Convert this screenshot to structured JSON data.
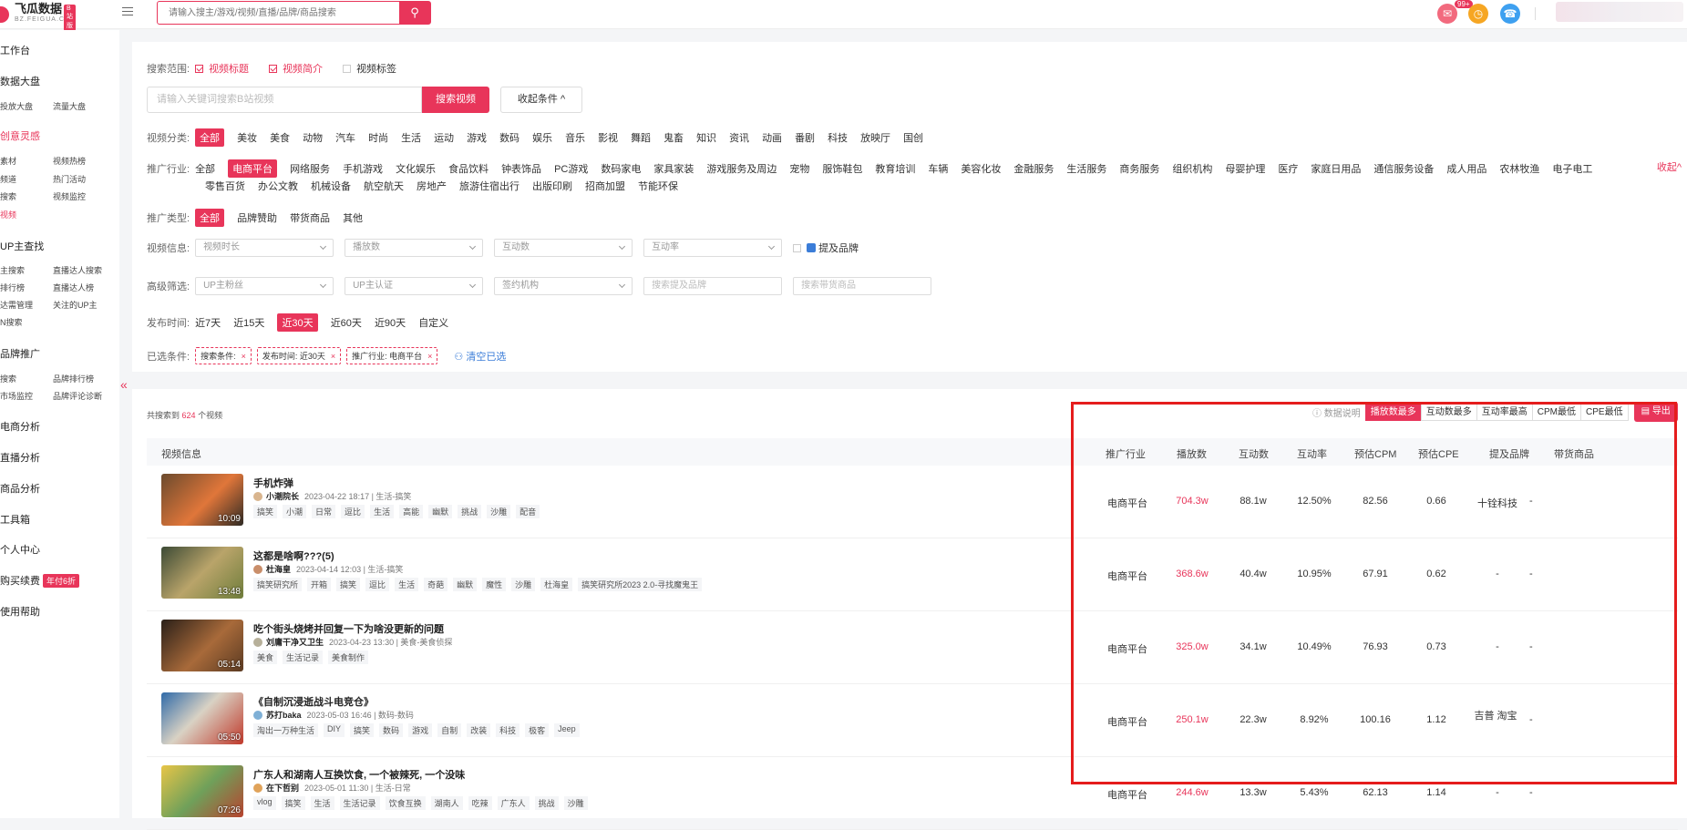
{
  "brand": {
    "name": "飞瓜数据",
    "sub": "BZ.FEIGUA.CN",
    "badge": "B站版"
  },
  "top_search": {
    "placeholder": "请输入搜主/游戏/视频/直播/品牌/商品搜索"
  },
  "notify_badge": "99+",
  "sidebar": {
    "sections": [
      {
        "label": "工作台",
        "active": false
      },
      {
        "label": "数据大盘",
        "active": false,
        "items": [
          "投放大盘",
          "流量大盘"
        ]
      },
      {
        "label": "创意灵感",
        "active": true,
        "items": [
          "素材",
          "视频热榜",
          "频道",
          "热门活动",
          "搜索",
          "视频监控",
          "视频"
        ]
      },
      {
        "label": "UP主查找",
        "active": false,
        "items": [
          "主搜索",
          "直播达人搜索",
          "排行榜",
          "直播达人榜",
          "达需管理",
          "关注的UP主",
          "N搜索"
        ]
      },
      {
        "label": "品牌推广",
        "active": false,
        "items": [
          "搜索",
          "品牌排行榜",
          "市场监控",
          "品牌评论诊断"
        ]
      },
      {
        "label": "电商分析",
        "active": false
      },
      {
        "label": "直播分析",
        "active": false
      },
      {
        "label": "商品分析",
        "active": false
      },
      {
        "label": "工具箱",
        "active": false
      },
      {
        "label": "个人中心",
        "active": false
      },
      {
        "label": "购买续费",
        "active": false,
        "tag": "年付6折"
      },
      {
        "label": "使用帮助",
        "active": false
      }
    ]
  },
  "filters": {
    "scope_label": "搜索范围:",
    "scope": [
      {
        "label": "视频标题",
        "on": true
      },
      {
        "label": "视频简介",
        "on": true
      },
      {
        "label": "视频标签",
        "on": false
      }
    ],
    "keyword_placeholder": "请输入关键词搜索B站视频",
    "search_btn": "搜索视频",
    "collapse_btn": "收起条件 ^",
    "category_label": "视频分类:",
    "categories": [
      "全部",
      "美妆",
      "美食",
      "动物",
      "汽车",
      "时尚",
      "生活",
      "运动",
      "游戏",
      "数码",
      "娱乐",
      "音乐",
      "影视",
      "舞蹈",
      "鬼畜",
      "知识",
      "资讯",
      "动画",
      "番剧",
      "科技",
      "放映厅",
      "国创"
    ],
    "industry_label": "推广行业:",
    "industries_row1": [
      "全部",
      "电商平台",
      "网络服务",
      "手机游戏",
      "文化娱乐",
      "食品饮料",
      "钟表饰品",
      "PC游戏",
      "数码家电",
      "家具家装",
      "游戏服务及周边",
      "宠物",
      "服饰鞋包",
      "教育培训",
      "车辆",
      "美容化妆",
      "金融服务",
      "生活服务",
      "商务服务",
      "组织机构",
      "母婴护理",
      "医疗",
      "家庭日用品",
      "通信服务设备",
      "成人用品",
      "农林牧渔",
      "电子电工"
    ],
    "industries_row2": [
      "零售百货",
      "办公文教",
      "机械设备",
      "航空航天",
      "房地产",
      "旅游住宿出行",
      "出版印刷",
      "招商加盟",
      "节能环保"
    ],
    "fold_right": "收起^",
    "promo_label": "推广类型:",
    "promo_types": [
      "全部",
      "品牌赞助",
      "带货商品",
      "其他"
    ],
    "info_label": "视频信息:",
    "info_selects": [
      "视频时长",
      "播放数",
      "互动数",
      "互动率"
    ],
    "info_checkbox": "提及品牌",
    "adv_label": "高级筛选:",
    "adv_selects": [
      "UP主粉丝",
      "UP主认证",
      "签约机构"
    ],
    "adv_search": [
      "搜索提及品牌",
      "搜索带货商品"
    ],
    "time_label": "发布时间:",
    "times": [
      "近7天",
      "近15天",
      "近30天",
      "近60天",
      "近90天",
      "自定义"
    ],
    "chosen_label": "已选条件:",
    "chips": [
      "搜索条件:",
      "发布时间: 近30天",
      "推广行业: 电商平台"
    ],
    "clear": "清空已选"
  },
  "results": {
    "count_prefix": "共搜索到",
    "count": "624",
    "count_suffix": "个视频",
    "help": "数据说明",
    "sorts": [
      "播放数最多",
      "互动数最多",
      "互动率最高",
      "CPM最低",
      "CPE最低"
    ],
    "export": "导出",
    "headers": [
      "视频信息",
      "推广行业",
      "播放数",
      "互动数",
      "互动率",
      "预估CPM",
      "预估CPE",
      "提及品牌",
      "带货商品"
    ],
    "rows": [
      {
        "title": "手机炸弹",
        "author": "小潮院长",
        "date": "2023-04-22 18:17",
        "cat": "生活-搞笑",
        "duration": "10:09",
        "tags": [
          "搞笑",
          "小潮",
          "日常",
          "逗比",
          "生活",
          "高能",
          "幽默",
          "挑战",
          "沙雕",
          "配音"
        ],
        "industry": "电商平台",
        "plays": "704.3w",
        "interact": "88.1w",
        "rate": "12.50%",
        "cpm": "82.56",
        "cpe": "0.66",
        "brand": "十铨科技",
        "goods": "-"
      },
      {
        "title": "这都是啥啊???(5)",
        "author": "杜海皇",
        "date": "2023-04-14 12:03",
        "cat": "生活-搞笑",
        "duration": "13:48",
        "tags": [
          "搞笑研究所",
          "开箱",
          "搞笑",
          "逗比",
          "生活",
          "奇葩",
          "幽默",
          "魔性",
          "沙雕",
          "杜海皇",
          "搞笑研究所2023 2.0-寻找魔鬼王"
        ],
        "industry": "电商平台",
        "plays": "368.6w",
        "interact": "40.4w",
        "rate": "10.95%",
        "cpm": "67.91",
        "cpe": "0.62",
        "brand": "-",
        "goods": "-"
      },
      {
        "title": "吃个街头烧烤并回复一下为啥没更新的问题",
        "author": "刘庸干净又卫生",
        "date": "2023-04-23 13:30",
        "cat": "美食-美食侦探",
        "duration": "05:14",
        "tags": [
          "美食",
          "生活记录",
          "美食制作"
        ],
        "industry": "电商平台",
        "plays": "325.0w",
        "interact": "34.1w",
        "rate": "10.49%",
        "cpm": "76.93",
        "cpe": "0.73",
        "brand": "-",
        "goods": "-"
      },
      {
        "title": "《自制沉浸逝战斗电竞仓》",
        "author": "苏打baka",
        "date": "2023-05-03 16:46",
        "cat": "数码-数码",
        "duration": "05:50",
        "tags": [
          "淘出一万种生活",
          "DIY",
          "搞笑",
          "数码",
          "游戏",
          "自制",
          "改装",
          "科技",
          "极客",
          "Jeep"
        ],
        "industry": "电商平台",
        "plays": "250.1w",
        "interact": "22.3w",
        "rate": "8.92%",
        "cpm": "100.16",
        "cpe": "1.12",
        "brand": "吉普 淘宝",
        "goods": "-"
      },
      {
        "title": "广东人和湖南人互换饮食, 一个被辣死, 一个没味",
        "author": "在下哲别",
        "date": "2023-05-01 11:30",
        "cat": "生活-日常",
        "duration": "07:26",
        "tags": [
          "vlog",
          "搞笑",
          "生活",
          "生活记录",
          "饮食互换",
          "湖南人",
          "吃辣",
          "广东人",
          "挑战",
          "沙雕"
        ],
        "industry": "电商平台",
        "plays": "244.6w",
        "interact": "13.3w",
        "rate": "5.43%",
        "cpm": "62.13",
        "cpe": "1.14",
        "brand": "-",
        "goods": "-"
      }
    ]
  }
}
